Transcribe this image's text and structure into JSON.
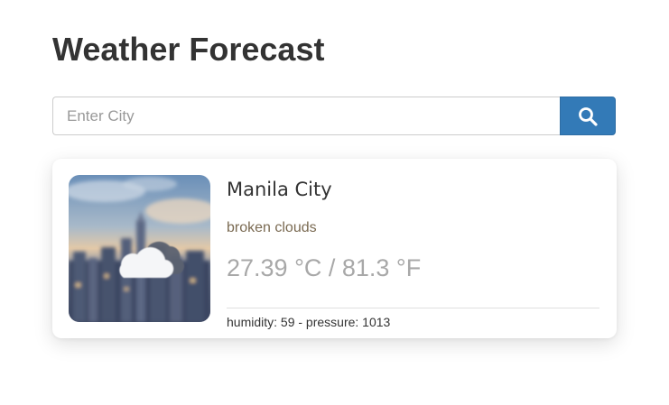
{
  "page": {
    "title": "Weather Forecast"
  },
  "search": {
    "placeholder": "Enter City",
    "value": "",
    "button_icon": "search-icon"
  },
  "weather_card": {
    "image": "city-skyline-photo",
    "overlay_icon": "cloud-icon",
    "city": "Manila City",
    "description": "broken clouds",
    "temperature": "27.39 °C / 81.3 °F",
    "details": "humidity: 59 - pressure: 1013"
  },
  "colors": {
    "accent": "#337ab7",
    "title": "#333333",
    "description": "#7a6a52",
    "temperature": "#a8a8a8"
  }
}
